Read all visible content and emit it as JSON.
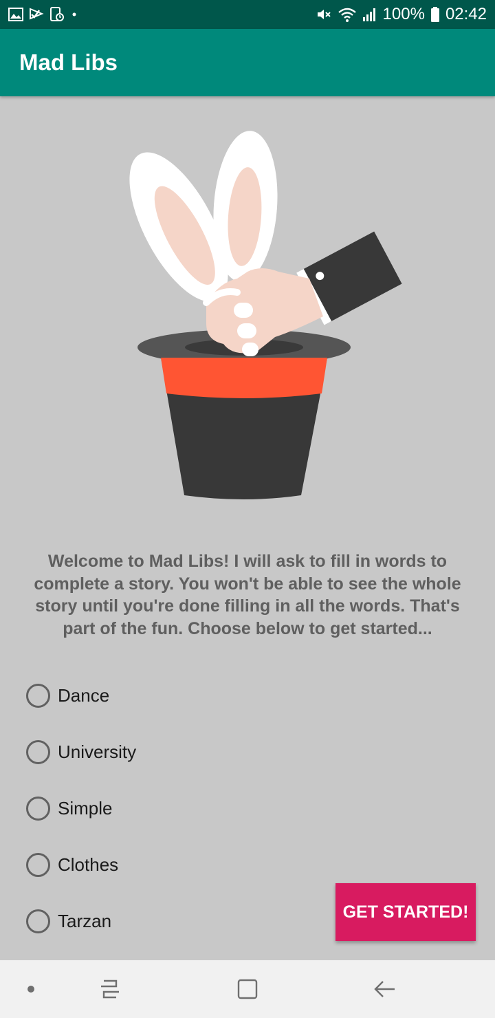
{
  "status_bar": {
    "battery_text": "100%",
    "time": "02:42",
    "icons_left": [
      "gallery-icon",
      "check-flag-icon",
      "device-clock-icon",
      "dot-icon"
    ],
    "icons_right": [
      "mute-icon",
      "wifi-icon",
      "signal-icon",
      "battery-icon"
    ]
  },
  "app_bar": {
    "title": "Mad Libs",
    "color": "#00897b"
  },
  "illustration": {
    "icon": "magician-hat-rabbit-illustration"
  },
  "welcome": {
    "text": "Welcome to Mad Libs! I will ask to fill in words to complete a story. You won't be able to see the whole story until you're done filling in all the words. That's part of the fun. Choose below to get started..."
  },
  "stories": {
    "options": [
      {
        "label": "Dance",
        "selected": false
      },
      {
        "label": "University",
        "selected": false
      },
      {
        "label": "Simple",
        "selected": false
      },
      {
        "label": "Clothes",
        "selected": false
      },
      {
        "label": "Tarzan",
        "selected": false
      }
    ]
  },
  "actions": {
    "start_label": "GET STARTED!",
    "start_color": "#d81b60"
  },
  "nav_bar": {
    "icons": [
      "nav-dot-icon",
      "recents-icon",
      "home-icon",
      "back-icon"
    ]
  }
}
